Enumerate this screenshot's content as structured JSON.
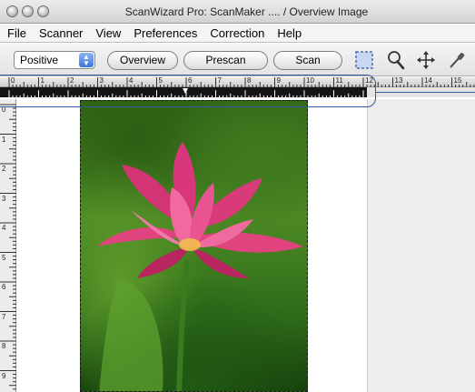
{
  "window": {
    "title": "ScanWizard Pro: ScanMaker .... / Overview Image"
  },
  "menu": [
    "File",
    "Scanner",
    "View",
    "Preferences",
    "Correction",
    "Help"
  ],
  "toolbar": {
    "mode_select": "Positive",
    "overview_label": "Overview",
    "prescan_label": "Prescan",
    "scan_label": "Scan",
    "tools": [
      "marquee-icon",
      "zoom-icon",
      "move-icon",
      "eyedropper-icon"
    ]
  },
  "ruler": {
    "top_labels": [
      "0",
      "1",
      "2",
      "3",
      "4",
      "5",
      "6",
      "7",
      "8",
      "9",
      "10",
      "11",
      "12",
      "13",
      "14",
      "15"
    ],
    "left_labels": [
      "0",
      "1",
      "2",
      "3",
      "4",
      "5",
      "6",
      "7",
      "8",
      "9"
    ]
  },
  "colors": {
    "callout": "#2f5aa8",
    "accent": "#3d76d8",
    "petal": "#e0447f"
  }
}
